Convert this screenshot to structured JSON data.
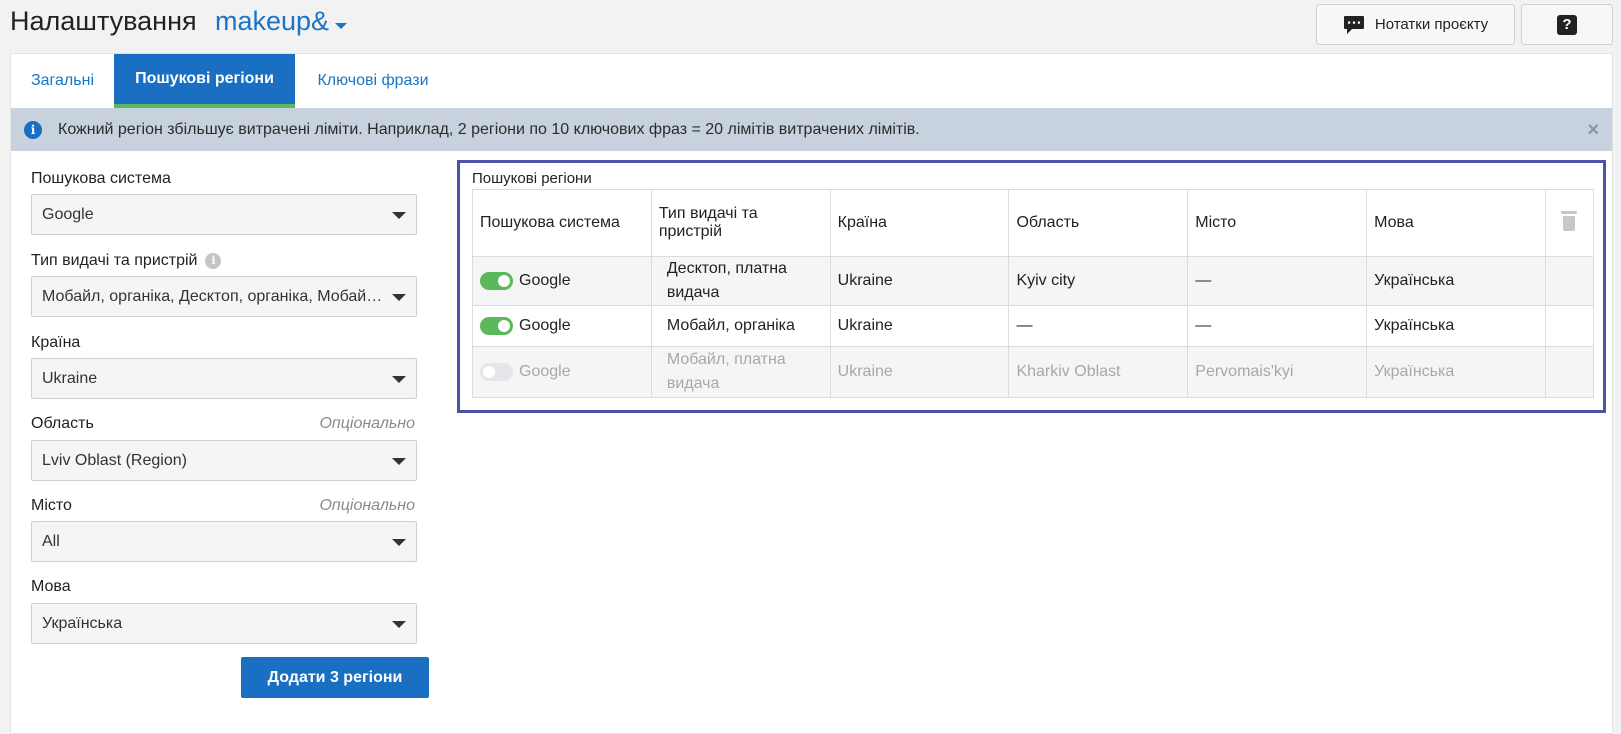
{
  "header": {
    "title": "Налаштування",
    "project": "makeup&",
    "notes_button": "Нотатки проєкту",
    "help_button": "?"
  },
  "tabs": [
    {
      "label": "Загальні",
      "active": false
    },
    {
      "label": "Пошукові регіони",
      "active": true
    },
    {
      "label": "Ключові фрази",
      "active": false
    }
  ],
  "alert": {
    "text": "Кожний регіон збільшує витрачені ліміти. Наприклад, 2 регіони по 10 ключових фраз = 20 лімітів витрачених лімітів."
  },
  "form": {
    "search_engine": {
      "label": "Пошукова система",
      "value": "Google"
    },
    "serp_device": {
      "label": "Тип видачі та пристрій",
      "value": "Мобайл, органіка, Десктоп, органіка, Мобайл, платна видача"
    },
    "country": {
      "label": "Країна",
      "value": "Ukraine"
    },
    "region": {
      "label": "Область",
      "optional": "Опціонально",
      "value": "Lviv Oblast (Region)"
    },
    "city": {
      "label": "Місто",
      "optional": "Опціонально",
      "value": "All"
    },
    "language": {
      "label": "Мова",
      "value": "Українська"
    },
    "add_button": "Додати 3 регіони"
  },
  "regions": {
    "title": "Пошукові регіони",
    "headers": {
      "engine": "Пошукова система",
      "serp": "Тип видачі та пристрій",
      "country": "Країна",
      "region": "Область",
      "city": "Місто",
      "language": "Мова"
    },
    "rows": [
      {
        "enabled": true,
        "engine": "Google",
        "serp": "Десктоп, платна видача",
        "country": "Ukraine",
        "region": "Kyiv city",
        "city": "—",
        "language": "Українська"
      },
      {
        "enabled": true,
        "engine": "Google",
        "serp": "Мобайл, органіка",
        "country": "Ukraine",
        "region": "—",
        "city": "—",
        "language": "Українська"
      },
      {
        "enabled": false,
        "engine": "Google",
        "serp": "Мобайл, платна видача",
        "country": "Ukraine",
        "region": "Kharkiv Oblast",
        "city": "Pervomais'kyi",
        "language": "Українська"
      }
    ]
  },
  "colors": {
    "accent": "#1b6fc2",
    "link": "#1b74c5",
    "toggle_on": "#5cb85c",
    "highlight_border": "#4d52a8"
  }
}
